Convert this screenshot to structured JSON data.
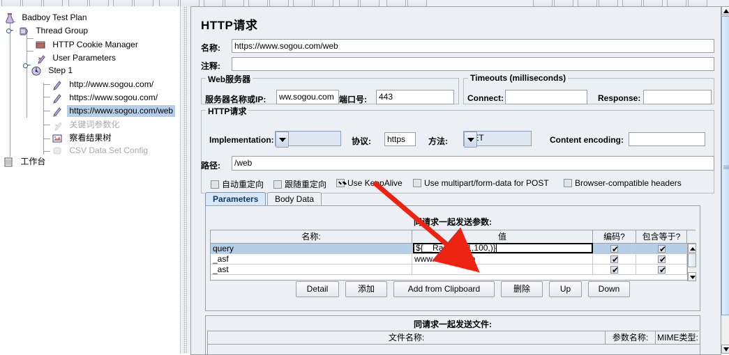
{
  "tree": {
    "items": [
      {
        "label": "Badboy Test Plan",
        "icon": "test-plan-icon",
        "depth": 0,
        "selected": false,
        "disabled": false
      },
      {
        "label": "Thread Group",
        "icon": "thread-group-icon",
        "depth": 1,
        "selected": false,
        "disabled": false
      },
      {
        "label": "HTTP Cookie Manager",
        "icon": "cookie-manager-icon",
        "depth": 2,
        "selected": false,
        "disabled": false
      },
      {
        "label": "User Parameters",
        "icon": "user-parameters-icon",
        "depth": 2,
        "selected": false,
        "disabled": false
      },
      {
        "label": "Step 1",
        "icon": "transaction-controller-icon",
        "depth": 2,
        "selected": false,
        "disabled": false
      },
      {
        "label": "http://www.sogou.com/",
        "icon": "http-sampler-icon",
        "depth": 3,
        "selected": false,
        "disabled": false
      },
      {
        "label": "https://www.sogou.com/",
        "icon": "http-sampler-icon",
        "depth": 3,
        "selected": false,
        "disabled": false
      },
      {
        "label": "https://www.sogou.com/web",
        "icon": "http-sampler-icon",
        "depth": 3,
        "selected": true,
        "disabled": false
      },
      {
        "label": "关键词参数化",
        "icon": "user-parameters-icon",
        "depth": 3,
        "selected": false,
        "disabled": true
      },
      {
        "label": "察看结果树",
        "icon": "view-results-tree-icon",
        "depth": 3,
        "selected": false,
        "disabled": false
      },
      {
        "label": "CSV Data Set Config",
        "icon": "csv-data-set-icon",
        "depth": 3,
        "selected": false,
        "disabled": true
      },
      {
        "label": "工作台",
        "icon": "workbench-icon",
        "depth": 0,
        "selected": false,
        "disabled": false
      }
    ]
  },
  "panel": {
    "title": "HTTP请求",
    "name_label": "名称:",
    "name_value": "https://www.sogou.com/web",
    "comment_label": "注释:",
    "comment_value": ""
  },
  "web_server": {
    "group_title": "Web服务器",
    "server_label": "服务器名称或IP:",
    "server_value": "ww.sogou.com",
    "port_label": "端口号:",
    "port_value": "443"
  },
  "timeouts": {
    "group_title": "Timeouts (milliseconds)",
    "connect_label": "Connect:",
    "connect_value": "",
    "response_label": "Response:",
    "response_value": ""
  },
  "http_request": {
    "group_title": "HTTP请求",
    "implementation_label": "Implementation:",
    "implementation_value": "",
    "protocol_label": "协议:",
    "protocol_value": "https",
    "method_label": "方法:",
    "method_value": "GET",
    "content_encoding_label": "Content encoding:",
    "content_encoding_value": "",
    "path_label": "路径:",
    "path_value": "/web",
    "checkboxes": [
      {
        "label": "自动重定向",
        "checked": false
      },
      {
        "label": "跟随重定向",
        "checked": false
      },
      {
        "label": "Use KeepAlive",
        "checked": true
      },
      {
        "label": "Use multipart/form-data for POST",
        "checked": false
      },
      {
        "label": "Browser-compatible headers",
        "checked": false
      }
    ]
  },
  "tabs": [
    {
      "label": "Parameters",
      "active": true
    },
    {
      "label": "Body Data",
      "active": false
    }
  ],
  "parameters": {
    "heading": "同请求一起发送参数:",
    "columns": [
      "名称:",
      "值",
      "编码?",
      "包含等于?"
    ],
    "rows": [
      {
        "name": "query",
        "value": "${__Random(1,100,)}",
        "encode": true,
        "include_equals": true,
        "selected": true,
        "editing": true
      },
      {
        "name": "_asf",
        "value": "www.sogou.com",
        "encode": true,
        "include_equals": true,
        "selected": false,
        "editing": false
      },
      {
        "name": "_ast",
        "value": "",
        "encode": true,
        "include_equals": true,
        "selected": false,
        "editing": false
      }
    ],
    "buttons": [
      "Detail",
      "添加",
      "Add from Clipboard",
      "删除",
      "Up",
      "Down"
    ]
  },
  "files": {
    "heading": "同请求一起发送文件:",
    "columns": [
      "文件名称:",
      "参数名称:",
      "MIME类型:"
    ]
  },
  "colors": {
    "selection": "#b5cfe8",
    "annotation_arrow": "#ee2211",
    "panel_bg": "#eceff3",
    "tab_active": "#d9e7f6"
  }
}
